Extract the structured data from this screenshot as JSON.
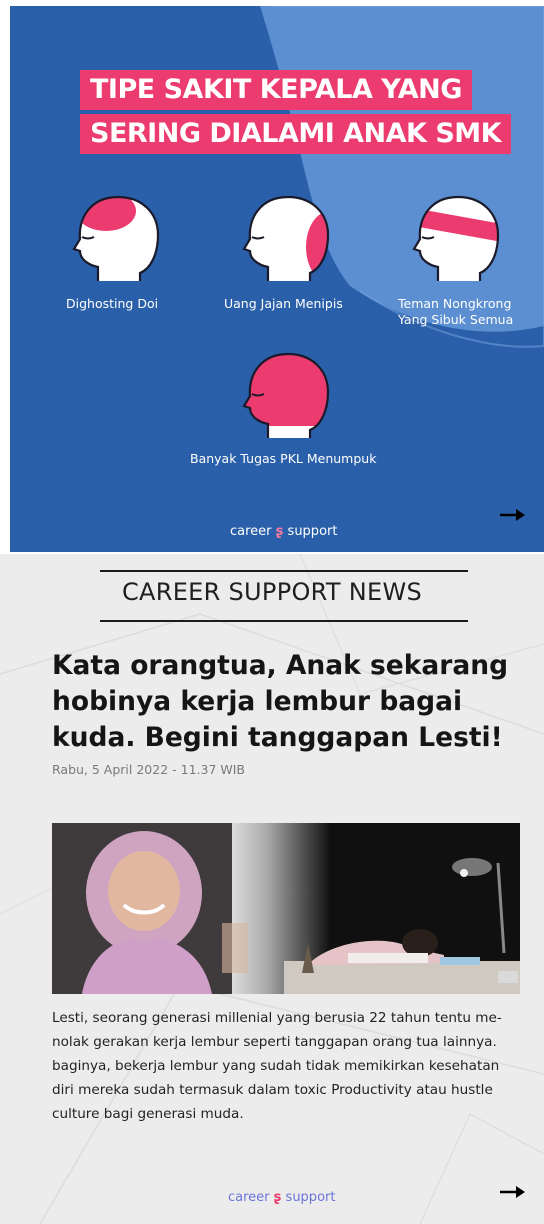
{
  "slide1": {
    "title_lines": [
      "TIPE SAKIT KEPALA YANG",
      "SERING DIALAMI ANAK SMK"
    ],
    "heads": [
      {
        "label": "Dighosting Doi",
        "pain_area": "forehead"
      },
      {
        "label": "Uang Jajan Menipis",
        "pain_area": "back of head"
      },
      {
        "label": "Teman Nongkrong\nYang Sibuk Semua",
        "pain_area": "band"
      },
      {
        "label": "Banyak Tugas PKL Menumpuk",
        "pain_area": "whole head"
      }
    ],
    "brand": {
      "left": "career",
      "right": "support"
    },
    "colors": {
      "background": "#2a60aa",
      "accent": "#ec3b6e",
      "pale_sweep": "#5b8fd1",
      "white": "#ffffff"
    },
    "next_icon": "arrow-right-icon"
  },
  "slide2": {
    "section_title": "CAREER SUPPORT NEWS",
    "headline": "Kata orangtua, Anak sekarang hobinya kerja lembur bagai kuda. Begini tanggapan Lesti!",
    "date": "Rabu, 5 April 2022 - 11.37 WIB",
    "body_lines": [
      "Lesti, seorang generasi millenial yang berusia 22 tahun tentu me-",
      "nolak gerakan kerja lembur seperti tanggapan orang tua lainnya.",
      "baginya, bekerja lembur yang sudah tidak memikirkan kesehatan",
      "diri mereka sudah termasuk dalam toxic Productivity atau hustle",
      "culture bagi generasi muda."
    ],
    "brand": {
      "left": "career",
      "right": "support"
    },
    "next_icon": "arrow-right-icon"
  }
}
